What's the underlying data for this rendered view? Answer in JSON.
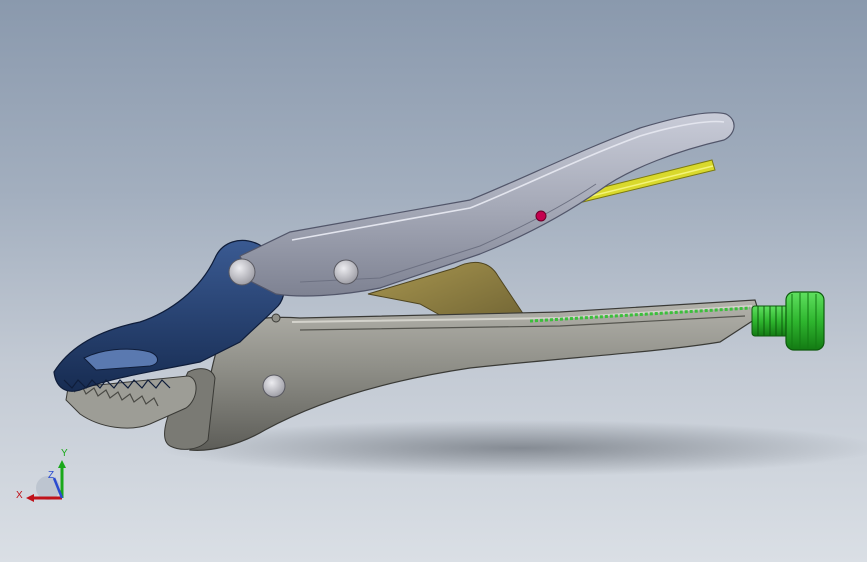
{
  "viewport": {
    "background_top": "#8a99ad",
    "background_bottom": "#dadfe5"
  },
  "model": {
    "parts": [
      {
        "name": "upper-handle",
        "color": "#a6aab8"
      },
      {
        "name": "lower-handle",
        "color": "#8f8f88"
      },
      {
        "name": "upper-jaw",
        "color": "#233f6e"
      },
      {
        "name": "release-lever",
        "color": "#8d7c42"
      },
      {
        "name": "adjusting-screw",
        "color": "#2fb62f"
      },
      {
        "name": "spring-rod",
        "color": "#d9d92c"
      },
      {
        "name": "pivot-pin",
        "color": "#c7c7cc"
      },
      {
        "name": "marker-dot",
        "color": "#c4004e"
      }
    ]
  },
  "triad": {
    "x_label": "X",
    "y_label": "Y",
    "z_label": "Z",
    "x_color": "#c0121a",
    "y_color": "#1aa81a",
    "z_color": "#2a4bd0"
  }
}
